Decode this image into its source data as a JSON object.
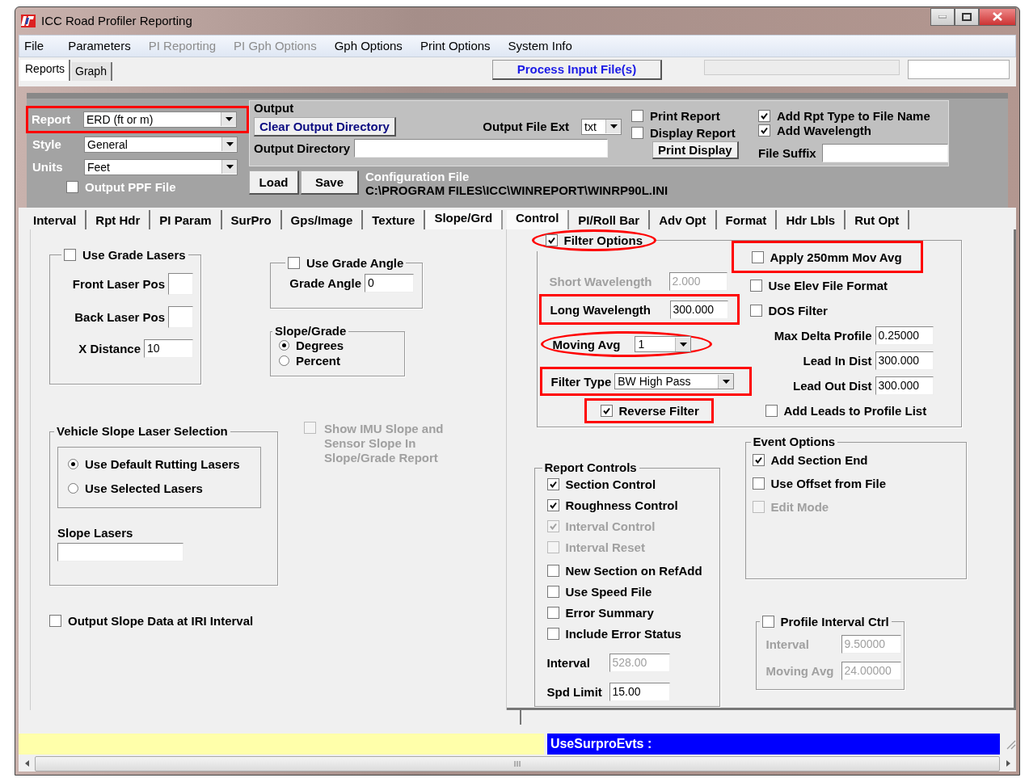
{
  "window": {
    "title": "ICC Road Profiler Reporting"
  },
  "menu": [
    {
      "label": "File",
      "disabled": false
    },
    {
      "label": "Parameters",
      "disabled": false
    },
    {
      "label": "PI Reporting",
      "disabled": true
    },
    {
      "label": "PI Gph Options",
      "disabled": true
    },
    {
      "label": "Gph Options",
      "disabled": false
    },
    {
      "label": "Print Options",
      "disabled": false
    },
    {
      "label": "System Info",
      "disabled": false
    }
  ],
  "view_tabs": [
    {
      "label": "Reports",
      "selected": true
    },
    {
      "label": "Graph",
      "selected": false
    }
  ],
  "process_button": "Process Input File(s)",
  "report_settings": [
    {
      "label": "Report",
      "value": "ERD (ft or m)",
      "boxed": true
    },
    {
      "label": "Style",
      "value": "General"
    },
    {
      "label": "Units",
      "value": "Feet"
    }
  ],
  "output_ppf": {
    "label": "Output PPF File",
    "checked": false
  },
  "output": {
    "title": "Output",
    "clear_button": "Clear Output Directory",
    "file_ext_label": "Output File Ext",
    "file_ext_value": "txt",
    "directory_label": "Output Directory",
    "checks": [
      {
        "label": "Print Report",
        "checked": false
      },
      {
        "label": "Display Report",
        "checked": false
      }
    ],
    "print_display_button": "Print Display",
    "name_checks": [
      {
        "label": "Add Rpt Type to File Name",
        "checked": true
      },
      {
        "label": "Add Wavelength",
        "checked": true
      }
    ],
    "suffix_label": "File Suffix"
  },
  "config": {
    "buttons": [
      "Load",
      "Save"
    ],
    "label": "Configuration File",
    "path": "C:\\PROGRAM FILES\\ICC\\WINREPORT\\WINRP90L.INI"
  },
  "left_tabs": [
    {
      "label": "Interval",
      "selected": false
    },
    {
      "label": "Rpt Hdr",
      "selected": false
    },
    {
      "label": "PI Param",
      "selected": false
    },
    {
      "label": "SurPro",
      "selected": false
    },
    {
      "label": "Gps/Image",
      "selected": false
    },
    {
      "label": "Texture",
      "selected": false
    },
    {
      "label": "Slope/Grd",
      "selected": true
    }
  ],
  "right_tabs": [
    {
      "label": "Control",
      "selected": true
    },
    {
      "label": "PI/Roll Bar",
      "selected": false
    },
    {
      "label": "Adv Opt",
      "selected": false
    },
    {
      "label": "Format",
      "selected": false
    },
    {
      "label": "Hdr Lbls",
      "selected": false
    },
    {
      "label": "Rut Opt",
      "selected": false
    }
  ],
  "grade_lasers": {
    "label": "Use Grade Lasers",
    "checked": false,
    "fields": [
      {
        "label": "Front Laser Pos"
      },
      {
        "label": "Back Laser Pos"
      },
      {
        "label": "X Distance",
        "value": "10"
      }
    ]
  },
  "grade_angle": {
    "label": "Use Grade Angle",
    "checked": false,
    "field_label": "Grade Angle",
    "value": "0"
  },
  "slope_grade": {
    "title": "Slope/Grade",
    "options": [
      {
        "label": "Degrees",
        "selected": true
      },
      {
        "label": "Percent",
        "selected": false
      }
    ]
  },
  "vehicle_slope": {
    "title": "Vehicle Slope Laser Selection",
    "options": [
      {
        "label": "Use Default Rutting Lasers",
        "selected": true
      },
      {
        "label": "Use Selected Lasers",
        "selected": false
      }
    ],
    "lasers_label": "Slope Lasers"
  },
  "imu_slope": {
    "label": "Show IMU Slope and Sensor Slope In Slope/Grade Report",
    "checked": false,
    "disabled": true
  },
  "output_slope": {
    "label": "Output Slope Data at IRI Interval",
    "checked": false
  },
  "filter": {
    "label": "Filter Options",
    "checked": true,
    "circled": true,
    "settings": [
      {
        "kind": "field",
        "label": "Short Wavelength",
        "value": "2.000",
        "disabled": true
      },
      {
        "kind": "field",
        "label": "Long Wavelength",
        "value": "300.000",
        "boxed": true
      },
      {
        "kind": "dropdown",
        "label": "Moving Avg",
        "value": "1",
        "circled": true
      },
      {
        "kind": "dropdown",
        "label": "Filter Type",
        "value": "BW High Pass",
        "boxed": true
      },
      {
        "kind": "checkbox",
        "label": "Reverse Filter",
        "checked": true,
        "boxed": true
      }
    ],
    "options": [
      {
        "kind": "checkbox",
        "label": "Apply 250mm Mov Avg",
        "checked": false,
        "boxed": true
      },
      {
        "kind": "checkbox",
        "label": "Use Elev File Format",
        "checked": false
      },
      {
        "kind": "checkbox",
        "label": "DOS Filter",
        "checked": false
      },
      {
        "kind": "field",
        "label": "Max Delta Profile",
        "value": "0.25000"
      },
      {
        "kind": "field",
        "label": "Lead In Dist",
        "value": "300.000"
      },
      {
        "kind": "field",
        "label": "Lead Out Dist",
        "value": "300.000"
      },
      {
        "kind": "checkbox",
        "label": "Add Leads to Profile List",
        "checked": false
      }
    ]
  },
  "report_controls": {
    "title": "Report Controls",
    "items": [
      {
        "label": "Section Control",
        "checked": true,
        "disabled": false
      },
      {
        "label": "Roughness Control",
        "checked": true,
        "disabled": false
      },
      {
        "label": "Interval Control",
        "checked": true,
        "disabled": true
      },
      {
        "label": "Interval Reset",
        "checked": false,
        "disabled": true
      },
      {
        "label": "New Section on RefAdd",
        "checked": false,
        "disabled": false
      },
      {
        "label": "Use Speed File",
        "checked": false,
        "disabled": false
      },
      {
        "label": "Error Summary",
        "checked": false,
        "disabled": false
      },
      {
        "label": "Include Error Status",
        "checked": false,
        "disabled": false
      }
    ],
    "fields": [
      {
        "label": "Interval",
        "value": "528.00",
        "disabled": true
      },
      {
        "label": "Spd Limit",
        "value": "15.00",
        "disabled": false
      }
    ]
  },
  "event_options": {
    "title": "Event Options",
    "items": [
      {
        "label": "Add Section End",
        "checked": true,
        "disabled": false
      },
      {
        "label": "Use Offset from File",
        "checked": false,
        "disabled": false
      },
      {
        "label": "Edit Mode",
        "checked": false,
        "disabled": true
      }
    ]
  },
  "profile_interval": {
    "label": "Profile Interval Ctrl",
    "checked": false,
    "fields": [
      {
        "label": "Interval",
        "value": "9.50000",
        "disabled": true
      },
      {
        "label": "Moving Avg",
        "value": "24.00000",
        "disabled": true
      }
    ]
  },
  "status_bar": {
    "message": "UseSurproEvts :"
  }
}
